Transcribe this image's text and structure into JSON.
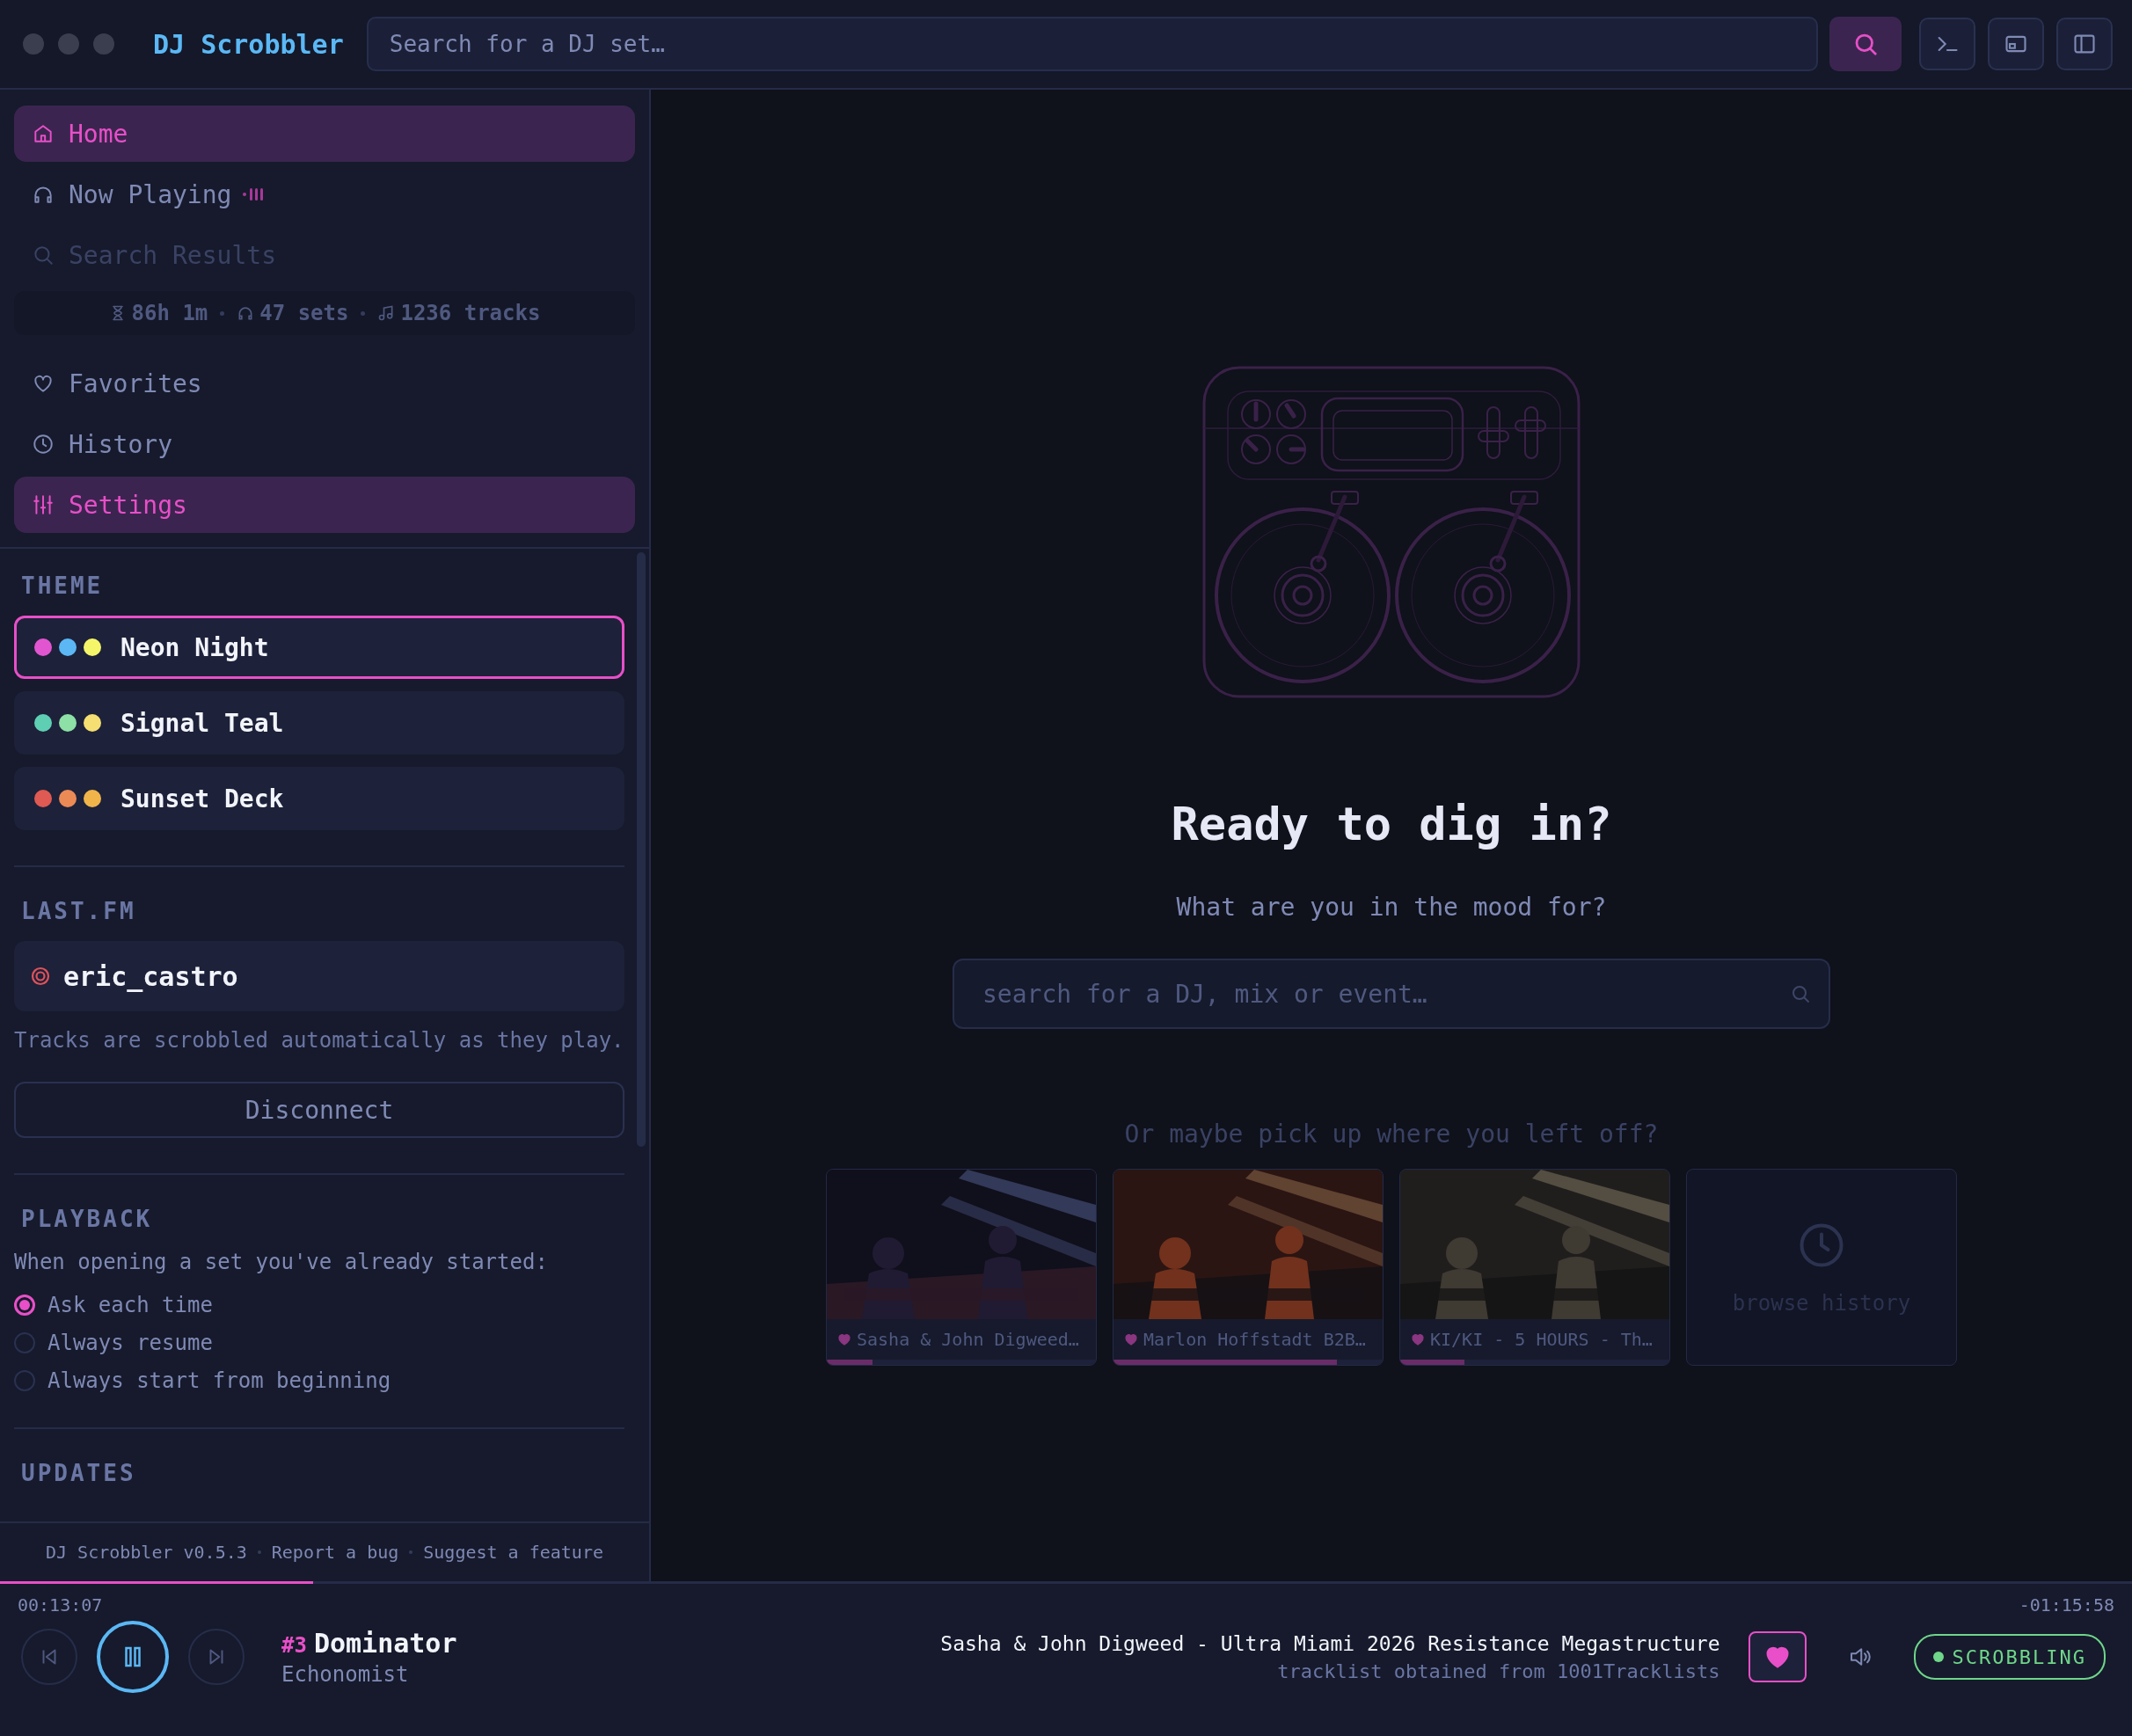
{
  "window": {
    "title": "DJ Scrobbler"
  },
  "top_search": {
    "placeholder": "Search for a DJ set…"
  },
  "sidebar": {
    "nav_top": [
      {
        "label": "Home",
        "selected": true,
        "disabled": false,
        "playing": false
      },
      {
        "label": "Now Playing",
        "selected": false,
        "disabled": false,
        "playing": true
      },
      {
        "label": "Search Results",
        "selected": false,
        "disabled": true,
        "playing": false
      }
    ],
    "stats": [
      "86h 1m",
      "47 sets",
      "1236 tracks"
    ],
    "nav_bottom": [
      {
        "label": "Favorites",
        "selected": false
      },
      {
        "label": "History",
        "selected": false
      },
      {
        "label": "Settings",
        "selected": true
      }
    ],
    "theme": {
      "heading": "THEME",
      "options": [
        {
          "name": "Neon Night",
          "selected": true,
          "dots": [
            {
              "color": "#e255d0"
            },
            {
              "color": "#5bb8f5"
            },
            {
              "color": "#f5f56a"
            }
          ]
        },
        {
          "name": "Signal Teal",
          "selected": false,
          "dots": [
            {
              "color": "#5fcfb4"
            },
            {
              "color": "#8de0a6"
            },
            {
              "color": "#f5df72"
            }
          ]
        },
        {
          "name": "Sunset Deck",
          "selected": false,
          "dots": [
            {
              "color": "#de5a52"
            },
            {
              "color": "#ec8a56"
            },
            {
              "color": "#f0b44a"
            }
          ]
        }
      ]
    },
    "lastfm": {
      "heading": "LAST.FM",
      "username": "eric_castro",
      "note": "Tracks are scrobbled automatically as they play.",
      "button": "Disconnect"
    },
    "playback": {
      "heading": "PLAYBACK",
      "prompt": "When opening a set you've already started:",
      "options": [
        {
          "label": "Ask each time",
          "selected": true
        },
        {
          "label": "Always resume",
          "selected": false
        },
        {
          "label": "Always start from beginning",
          "selected": false
        }
      ]
    },
    "updates": {
      "heading": "UPDATES"
    },
    "footer": [
      "DJ Scrobbler v0.5.3",
      "Report a bug",
      "Suggest a feature"
    ]
  },
  "main": {
    "heading": "Ready to dig in?",
    "subheading": "What are you in the mood for?",
    "search": {
      "placeholder": "search for a DJ, mix or event…"
    },
    "resume_prompt": "Or maybe pick up where you left off?",
    "recent": [
      {
        "title": "Sasha & John Digweed…",
        "favorite": true,
        "level": 0.17
      },
      {
        "title": "Marlon Hoffstadt B2B…",
        "favorite": true,
        "level": 0.83
      },
      {
        "title": "KI/KI - 5 HOURS - Th…",
        "favorite": true,
        "level": 0.24
      }
    ],
    "browse": "browse history"
  },
  "player": {
    "progress": {
      "level": 0.147
    },
    "elapsed": "00:13:07",
    "remaining": "-01:15:58",
    "playing": true,
    "track_number": "#3",
    "track": "Dominator",
    "artist": "Echonomist",
    "set_title": "Sasha & John Digweed - Ultra Miami 2026 Resistance Megastructure",
    "source": "tracklist obtained from 1001Tracklists",
    "liked": true,
    "status": "SCROBBLING"
  }
}
